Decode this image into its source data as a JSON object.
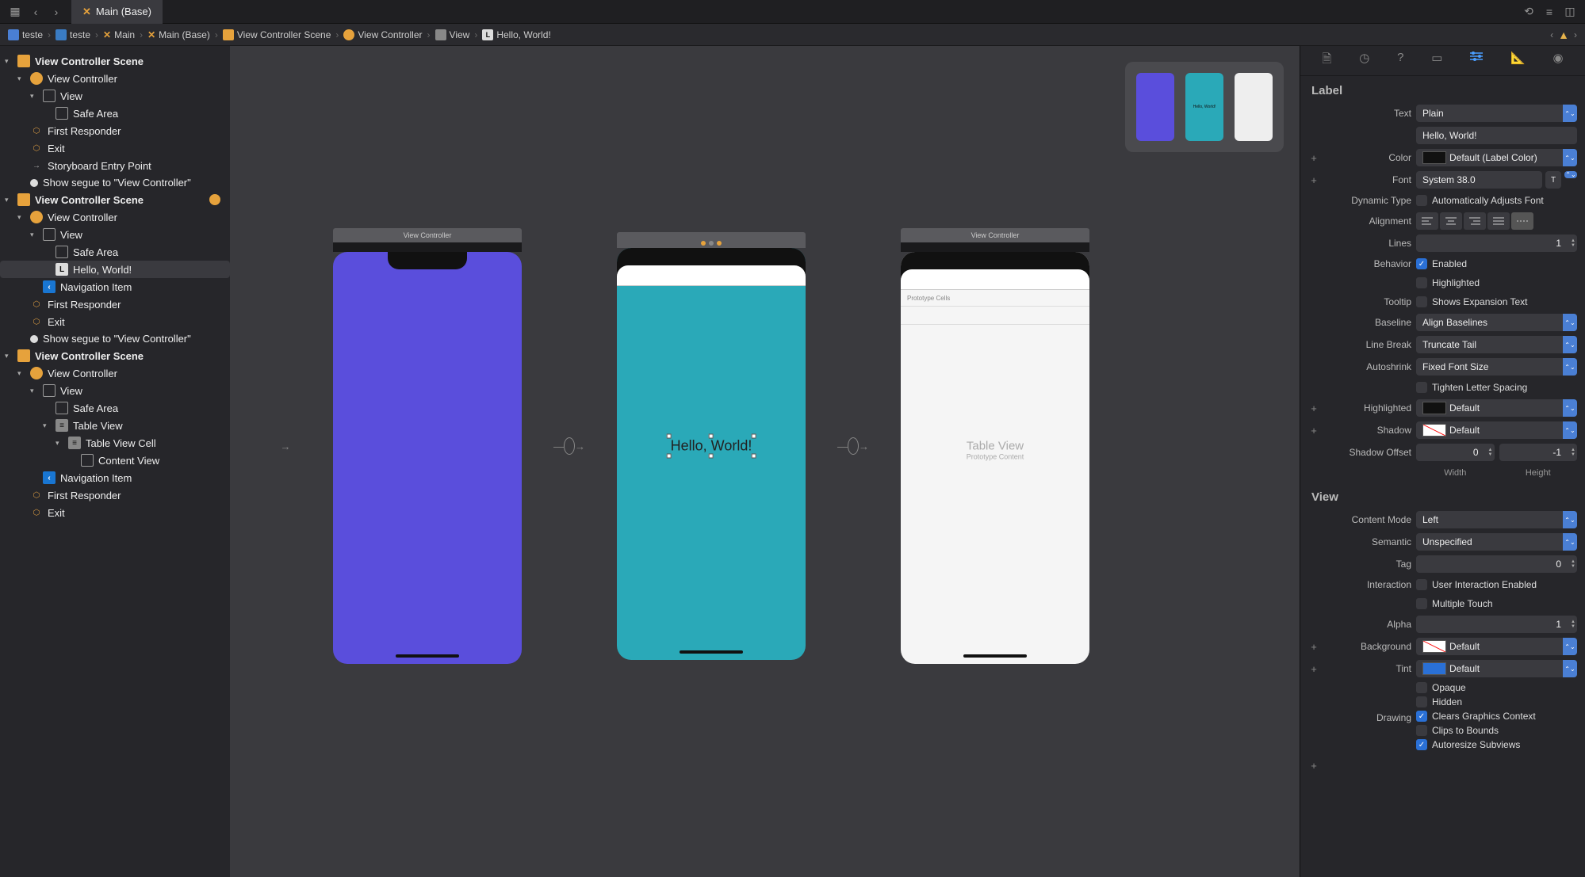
{
  "tab": {
    "title": "Main (Base)"
  },
  "breadcrumb": {
    "items": [
      "teste",
      "teste",
      "Main",
      "Main (Base)",
      "View Controller Scene",
      "View Controller",
      "View",
      "Hello, World!"
    ]
  },
  "outline": {
    "scenes": [
      {
        "title": "View Controller Scene",
        "badge": false,
        "children": [
          {
            "label": "View Controller",
            "icon": "vc",
            "children": [
              {
                "label": "View",
                "icon": "view",
                "children": [
                  {
                    "label": "Safe Area",
                    "icon": "safe"
                  }
                ]
              }
            ]
          },
          {
            "label": "First Responder",
            "icon": "cube"
          },
          {
            "label": "Exit",
            "icon": "cube"
          },
          {
            "label": "Storyboard Entry Point",
            "icon": "arrow"
          },
          {
            "label": "Show segue to \"View Controller\"",
            "icon": "dot"
          }
        ]
      },
      {
        "title": "View Controller Scene",
        "badge": true,
        "children": [
          {
            "label": "View Controller",
            "icon": "vc",
            "children": [
              {
                "label": "View",
                "icon": "view",
                "children": [
                  {
                    "label": "Safe Area",
                    "icon": "safe"
                  },
                  {
                    "label": "Hello, World!",
                    "icon": "label",
                    "selected": true
                  }
                ]
              },
              {
                "label": "Navigation Item",
                "icon": "nav"
              }
            ]
          },
          {
            "label": "First Responder",
            "icon": "cube"
          },
          {
            "label": "Exit",
            "icon": "cube"
          },
          {
            "label": "Show segue to \"View Controller\"",
            "icon": "dot"
          }
        ]
      },
      {
        "title": "View Controller Scene",
        "badge": false,
        "children": [
          {
            "label": "View Controller",
            "icon": "vc",
            "children": [
              {
                "label": "View",
                "icon": "view",
                "children": [
                  {
                    "label": "Safe Area",
                    "icon": "safe"
                  },
                  {
                    "label": "Table View",
                    "icon": "table",
                    "children": [
                      {
                        "label": "Table View Cell",
                        "icon": "table",
                        "children": [
                          {
                            "label": "Content View",
                            "icon": "view"
                          }
                        ]
                      }
                    ]
                  }
                ]
              },
              {
                "label": "Navigation Item",
                "icon": "nav"
              }
            ]
          },
          {
            "label": "First Responder",
            "icon": "cube"
          },
          {
            "label": "Exit",
            "icon": "cube"
          }
        ]
      }
    ]
  },
  "canvas": {
    "vc1_title": "View Controller",
    "vc2_title": "",
    "vc3_title": "View Controller",
    "hello_text": "Hello, World!",
    "proto_cells": "Prototype Cells",
    "tv_title": "Table View",
    "tv_sub": "Prototype Content",
    "minimap_hello": "Hello, World!"
  },
  "inspector": {
    "section1": "Label",
    "text_label": "Text",
    "text_mode": "Plain",
    "text_value": "Hello, World!",
    "color_label": "Color",
    "color_value": "Default (Label Color)",
    "font_label": "Font",
    "font_value": "System 38.0",
    "dyn_label": "Dynamic Type",
    "dyn_chk": "Automatically Adjusts Font",
    "align_label": "Alignment",
    "lines_label": "Lines",
    "lines_value": "1",
    "behavior_label": "Behavior",
    "behavior_enabled": "Enabled",
    "behavior_highlighted": "Highlighted",
    "tooltip_label": "Tooltip",
    "tooltip_chk": "Shows Expansion Text",
    "baseline_label": "Baseline",
    "baseline_value": "Align Baselines",
    "linebreak_label": "Line Break",
    "linebreak_value": "Truncate Tail",
    "autoshrink_label": "Autoshrink",
    "autoshrink_value": "Fixed Font Size",
    "tighten_chk": "Tighten Letter Spacing",
    "highlighted_label": "Highlighted",
    "highlighted_value": "Default",
    "shadow_label": "Shadow",
    "shadow_value": "Default",
    "shadow_offset_label": "Shadow Offset",
    "shadow_w": "0",
    "shadow_h": "-1",
    "width_label": "Width",
    "height_label": "Height",
    "section2": "View",
    "contentmode_label": "Content Mode",
    "contentmode_value": "Left",
    "semantic_label": "Semantic",
    "semantic_value": "Unspecified",
    "tag_label": "Tag",
    "tag_value": "0",
    "interaction_label": "Interaction",
    "interaction_uie": "User Interaction Enabled",
    "interaction_mt": "Multiple Touch",
    "alpha_label": "Alpha",
    "alpha_value": "1",
    "background_label": "Background",
    "background_value": "Default",
    "tint_label": "Tint",
    "tint_value": "Default",
    "drawing_label": "Drawing",
    "drawing_items": [
      "Opaque",
      "Hidden",
      "Clears Graphics Context",
      "Clips to Bounds",
      "Autoresize Subviews"
    ],
    "drawing_checked": [
      false,
      false,
      true,
      false,
      true
    ]
  }
}
